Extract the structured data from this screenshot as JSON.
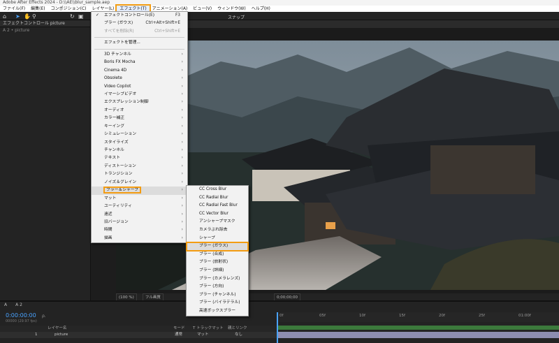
{
  "window": {
    "title": "Adobe After Effects 2024 - D:\\\\AE\\\\blur_sample.aep"
  },
  "menubar": {
    "items": [
      "ファイル(F)",
      "編集(E)",
      "コンポジション(C)",
      "レイヤー(L)",
      "エフェクト(T)",
      "アニメーション(A)",
      "ビュー(V)",
      "ウィンドウ(W)",
      "ヘルプ(H)"
    ],
    "active_index": 4
  },
  "toolbar": {
    "snap_label": "スナップ"
  },
  "left_panel": {
    "header": "エフェクトコントロール picture",
    "subheader": "A 2 • picture"
  },
  "effect_menu": {
    "top": [
      {
        "label": "エフェクトコントロール(E)",
        "shortcut": "F3",
        "checked": true,
        "disabled": false
      },
      {
        "label": "ブラー (ガウス)",
        "shortcut": "Ctrl+Alt+Shift+E",
        "checked": false,
        "disabled": false
      },
      {
        "label": "すべてを削除(R)",
        "shortcut": "Ctrl+Shift+E",
        "checked": false,
        "disabled": true
      }
    ],
    "manage": "エフェクトを管理...",
    "categories": [
      "3D チャンネル",
      "Boris FX Mocha",
      "Cinema 4D",
      "Obsolete",
      "Video Copilot",
      "イマーシブビデオ",
      "エクスプレッション制御",
      "オーディオ",
      "カラー補正",
      "キーイング",
      "シミュレーション",
      "スタイライズ",
      "チャンネル",
      "テキスト",
      "ディストーション",
      "トランジション",
      "ノイズ＆グレイン",
      "ブラー＆シャープ",
      "マット",
      "ユーティリティ",
      "遠近",
      "旧バージョン",
      "時間",
      "描画"
    ],
    "highlighted_index": 17
  },
  "blur_submenu": {
    "items": [
      "CC Cross Blur",
      "CC Radial Blur",
      "CC Radial Fast Blur",
      "CC Vector Blur",
      "アンシャープマスク",
      "カメラぶれ除去",
      "シャープ",
      "ブラー (ガウス)",
      "ブラー (合成)",
      "ブラー (放射状)",
      "ブラー (詳細)",
      "ブラー (カメラレンズ)",
      "ブラー (方向)",
      "ブラー (チャンネル)",
      "ブラー (バイラテラル)",
      "高速ボックスブラー"
    ],
    "highlighted_index": 7
  },
  "viewer_bar": {
    "zoom": "(100 %)",
    "quality": "フル画質",
    "timecode": "0;00;00;00"
  },
  "timeline": {
    "tabs": [
      "A",
      "A 2"
    ],
    "timecode": "0:00:00:00",
    "frames": "00000 (29.97 fps)",
    "search_placeholder": "ρ.",
    "columns": {
      "name": "レイヤー名",
      "mode": "モード",
      "track": "T トラックマット",
      "parent": "親とリンク"
    },
    "layer": {
      "number": "1",
      "name": "picture",
      "mode": "通常",
      "track": "マット",
      "parent": "なし"
    },
    "ruler": [
      "0f",
      "05f",
      "10f",
      "15f",
      "20f",
      "25f",
      "01:00f"
    ]
  },
  "colors": {
    "accent": "#4aa3ff",
    "highlight_box": "#f39c12"
  }
}
